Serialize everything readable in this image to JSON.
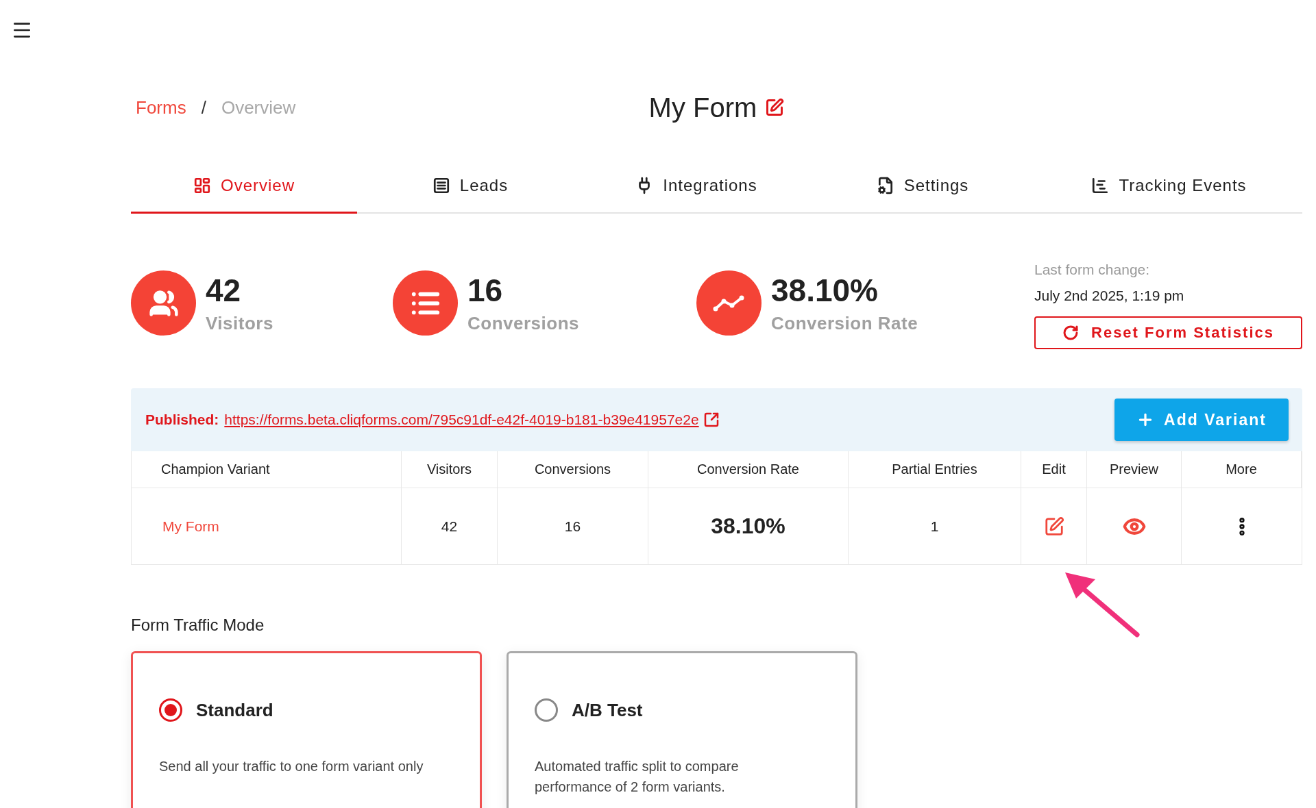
{
  "breadcrumb": {
    "separator": "/",
    "items": [
      {
        "label": "Forms",
        "current": false
      },
      {
        "label": "Overview",
        "current": true
      }
    ]
  },
  "title": "My Form",
  "tabs": [
    {
      "label": "Overview",
      "selected": true
    },
    {
      "label": "Leads",
      "selected": false
    },
    {
      "label": "Integrations",
      "selected": false
    },
    {
      "label": "Settings",
      "selected": false
    },
    {
      "label": "Tracking Events",
      "selected": false
    }
  ],
  "stats": [
    {
      "value": "42",
      "label": "Visitors"
    },
    {
      "value": "16",
      "label": "Conversions"
    },
    {
      "value": "38.10%",
      "label": "Conversion Rate"
    }
  ],
  "last_change": {
    "label": "Last form change:",
    "value": "July 2nd 2025, 1:19 pm"
  },
  "reset_button": "Reset Form Statistics",
  "published": {
    "label": "Published:",
    "url": "https://forms.beta.cliqforms.com/795c91df-e42f-4019-b181-b39e41957e2e"
  },
  "add_variant_button": "Add Variant",
  "table": {
    "columns": [
      "Champion Variant",
      "Visitors",
      "Conversions",
      "Conversion Rate",
      "Partial Entries",
      "Edit",
      "Preview",
      "More"
    ],
    "rows": [
      {
        "name": "My Form",
        "visitors": "42",
        "conversions": "16",
        "conversion_rate": "38.10%",
        "partial_entries": "1"
      }
    ]
  },
  "traffic_mode": {
    "title": "Form Traffic Mode",
    "options": [
      {
        "label": "Standard",
        "description": "Send all your traffic to one form variant only",
        "selected": true
      },
      {
        "label": "A/B Test",
        "description": "Automated traffic split to compare performance of 2 form variants.",
        "selected": false
      }
    ]
  }
}
